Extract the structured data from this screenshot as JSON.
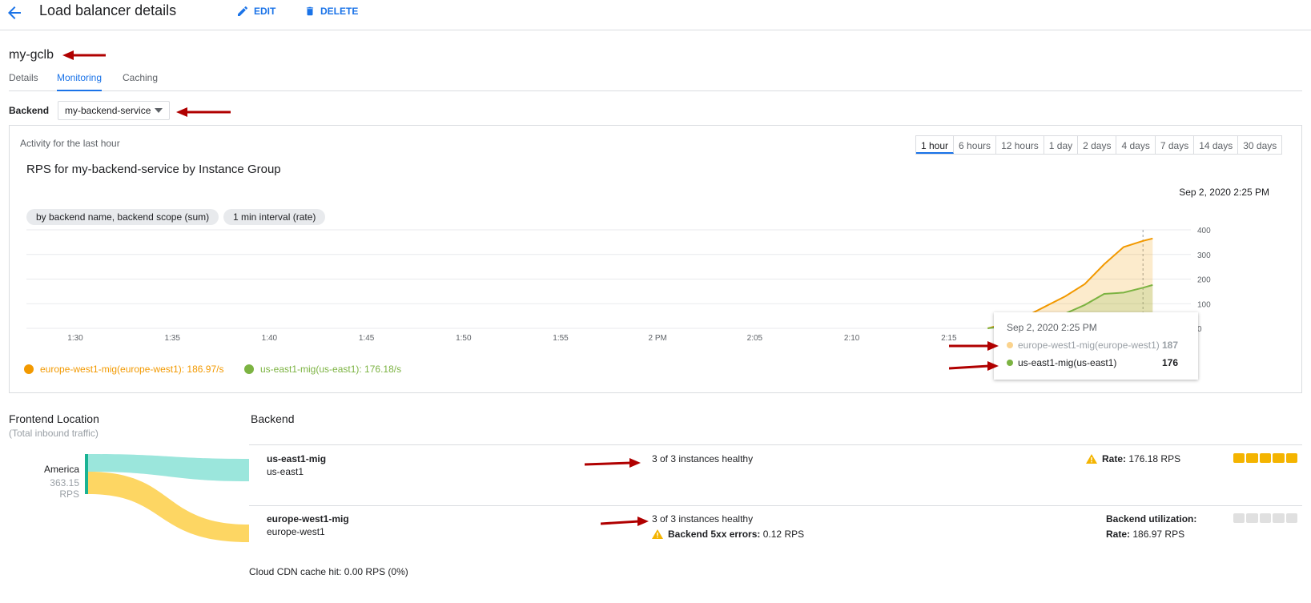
{
  "header": {
    "title": "Load balancer details",
    "edit": "EDIT",
    "delete": "DELETE"
  },
  "lb_name": "my-gclb",
  "tabs": [
    "Details",
    "Monitoring",
    "Caching"
  ],
  "backend_select": {
    "label": "Backend",
    "value": "my-backend-service"
  },
  "card": {
    "activity": "Activity for the last hour",
    "ranges": [
      "1 hour",
      "6 hours",
      "12 hours",
      "1 day",
      "2 days",
      "4 days",
      "7 days",
      "14 days",
      "30 days"
    ],
    "chart_title": "RPS for my-backend-service by Instance Group",
    "date": "Sep 2, 2020 2:25 PM",
    "chips": [
      "by backend name, backend scope (sum)",
      "1 min interval (rate)"
    ],
    "legend": [
      {
        "label": "europe-west1-mig(europe-west1): 186.97/s",
        "color": "#f29900"
      },
      {
        "label": "us-east1-mig(us-east1): 176.18/s",
        "color": "#7cb342"
      }
    ],
    "tooltip": {
      "date": "Sep 2, 2020 2:25 PM",
      "rows": [
        {
          "name": "europe-west1-mig(europe-west1)",
          "value": "187",
          "color": "#fbd38d"
        },
        {
          "name": "us-east1-mig(us-east1)",
          "value": "176",
          "color": "#7cb342"
        }
      ]
    }
  },
  "chart_data": {
    "type": "area",
    "x_ticks": [
      "1:30",
      "1:35",
      "1:40",
      "1:45",
      "1:50",
      "1:55",
      "2 PM",
      "2:05",
      "2:10",
      "2:15",
      "2:20",
      "2:25"
    ],
    "y_ticks": [
      "400",
      "300",
      "200",
      "100",
      "0"
    ],
    "ylim": [
      0,
      400
    ],
    "series": [
      {
        "name": "europe-west1-mig(europe-west1)",
        "color": "#f29900",
        "x": [
          "2:17",
          "2:18",
          "2:19",
          "2:20",
          "2:21",
          "2:22",
          "2:23",
          "2:24",
          "2:25",
          "2:25:30"
        ],
        "values": [
          0,
          20,
          50,
          90,
          130,
          180,
          260,
          330,
          355,
          365
        ]
      },
      {
        "name": "us-east1-mig(us-east1)",
        "color": "#7cb342",
        "x": [
          "2:17",
          "2:18",
          "2:19",
          "2:20",
          "2:21",
          "2:22",
          "2:23",
          "2:24",
          "2:25",
          "2:25:30"
        ],
        "values": [
          0,
          10,
          30,
          15,
          60,
          95,
          140,
          145,
          165,
          176
        ]
      }
    ]
  },
  "frontend": {
    "title": "Frontend Location",
    "subtitle": "(Total inbound traffic)",
    "location": "America",
    "rps": "363.15 RPS"
  },
  "backend_section": {
    "title": "Backend",
    "rows": [
      {
        "name": "us-east1-mig",
        "region": "us-east1",
        "health": "3 of 3 instances healthy",
        "rate_label": "Rate:",
        "rate": "176.18 RPS"
      },
      {
        "name": "europe-west1-mig",
        "region": "europe-west1",
        "health": "3 of 3 instances healthy",
        "errors_label": "Backend 5xx errors:",
        "errors": "0.12 RPS",
        "util_label": "Backend utilization:",
        "rate_label": "Rate:",
        "rate": "186.97 RPS"
      }
    ],
    "cdn": "Cloud CDN cache hit: 0.00 RPS (0%)"
  },
  "colors": {
    "accent": "#1a73e8",
    "arrow": "#b00000",
    "warn": "#f4b400"
  }
}
